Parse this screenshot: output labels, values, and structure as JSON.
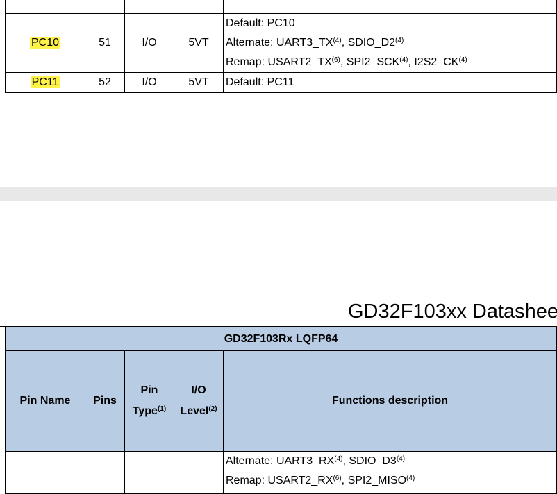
{
  "top_table": {
    "rows": [
      {
        "pin_name": "PC10",
        "pins": "51",
        "pin_type": "I/O",
        "io_level": "5VT",
        "functions": [
          {
            "label": "Default: PC10",
            "items": []
          },
          {
            "label": "Alternate: ",
            "items": [
              {
                "name": "UART3_TX",
                "note": "(4)"
              },
              {
                "name": "SDIO_D2",
                "note": "(4)"
              }
            ]
          },
          {
            "label": "Remap: ",
            "items": [
              {
                "name": "USART2_TX",
                "note": "(6)"
              },
              {
                "name": "SPI2_SCK",
                "note": "(4)"
              },
              {
                "name": "I2S2_CK",
                "note": "(4)"
              }
            ]
          }
        ]
      },
      {
        "pin_name": "PC11",
        "pins": "52",
        "pin_type": "I/O",
        "io_level": "5VT",
        "functions": [
          {
            "label": "Default: PC11",
            "items": []
          }
        ]
      }
    ]
  },
  "page_header": {
    "title": "GD32F103xx Datasheet"
  },
  "bottom_table": {
    "caption": "GD32F103Rx LQFP64",
    "headers": {
      "pin_name": "Pin Name",
      "pins": "Pins",
      "pin_type": "Pin",
      "pin_type_2": "Type",
      "pin_type_note": "(1)",
      "io_level": "I/O",
      "io_level_2": "Level",
      "io_level_note": "(2)",
      "functions": "Functions description"
    },
    "row": {
      "functions": [
        {
          "label": "Alternate: ",
          "items": [
            {
              "name": "UART3_RX",
              "note": "(4)"
            },
            {
              "name": "SDIO_D3",
              "note": "(4)"
            }
          ]
        },
        {
          "label": "Remap: ",
          "items": [
            {
              "name": "USART2_RX",
              "note": "(6)"
            },
            {
              "name": "SPI2_MISO",
              "note": "(4)"
            }
          ]
        }
      ]
    }
  },
  "colors": {
    "highlight": "#fff34a",
    "header_fill": "#b8cce4",
    "page_gap": "#e8e8e8"
  }
}
